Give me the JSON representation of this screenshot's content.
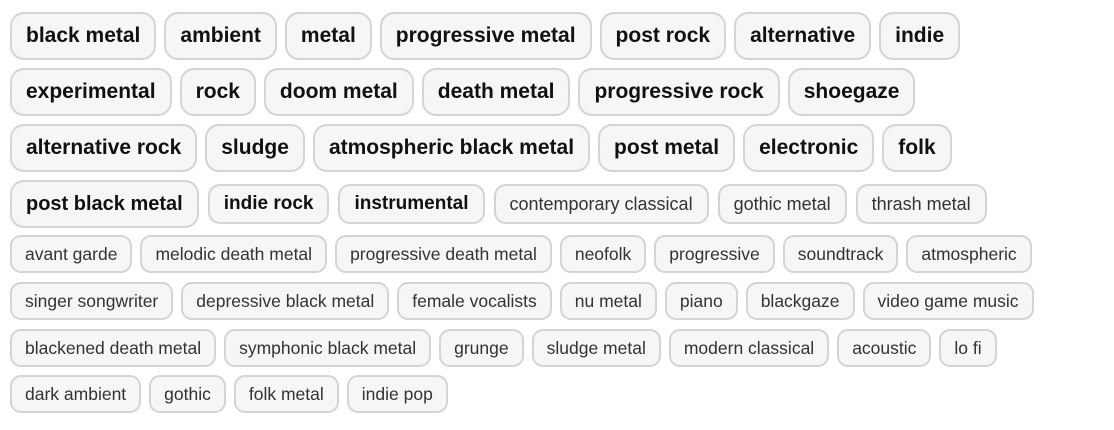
{
  "tags": {
    "rows": [
      [
        "black metal",
        "ambient",
        "metal",
        "progressive metal",
        "post rock",
        "alternative",
        "indie"
      ],
      [
        "experimental",
        "rock",
        "doom metal",
        "death metal",
        "progressive rock",
        "shoegaze"
      ],
      [
        "alternative rock",
        "sludge",
        "atmospheric black metal",
        "post metal",
        "electronic",
        "folk"
      ],
      [
        "post black metal",
        "indie rock",
        "instrumental",
        "contemporary classical",
        "gothic metal",
        "thrash metal"
      ],
      [
        "avant garde",
        "melodic death metal",
        "progressive death metal",
        "neofolk",
        "progressive",
        "soundtrack",
        "atmospheric"
      ],
      [
        "singer songwriter",
        "depressive black metal",
        "female vocalists",
        "nu metal",
        "piano",
        "blackgaze",
        "video game music"
      ],
      [
        "blackened death metal",
        "symphonic black metal",
        "grunge",
        "sludge metal",
        "modern classical",
        "acoustic",
        "lo fi"
      ],
      [
        "dark ambient",
        "gothic",
        "folk metal",
        "indie pop"
      ]
    ]
  }
}
